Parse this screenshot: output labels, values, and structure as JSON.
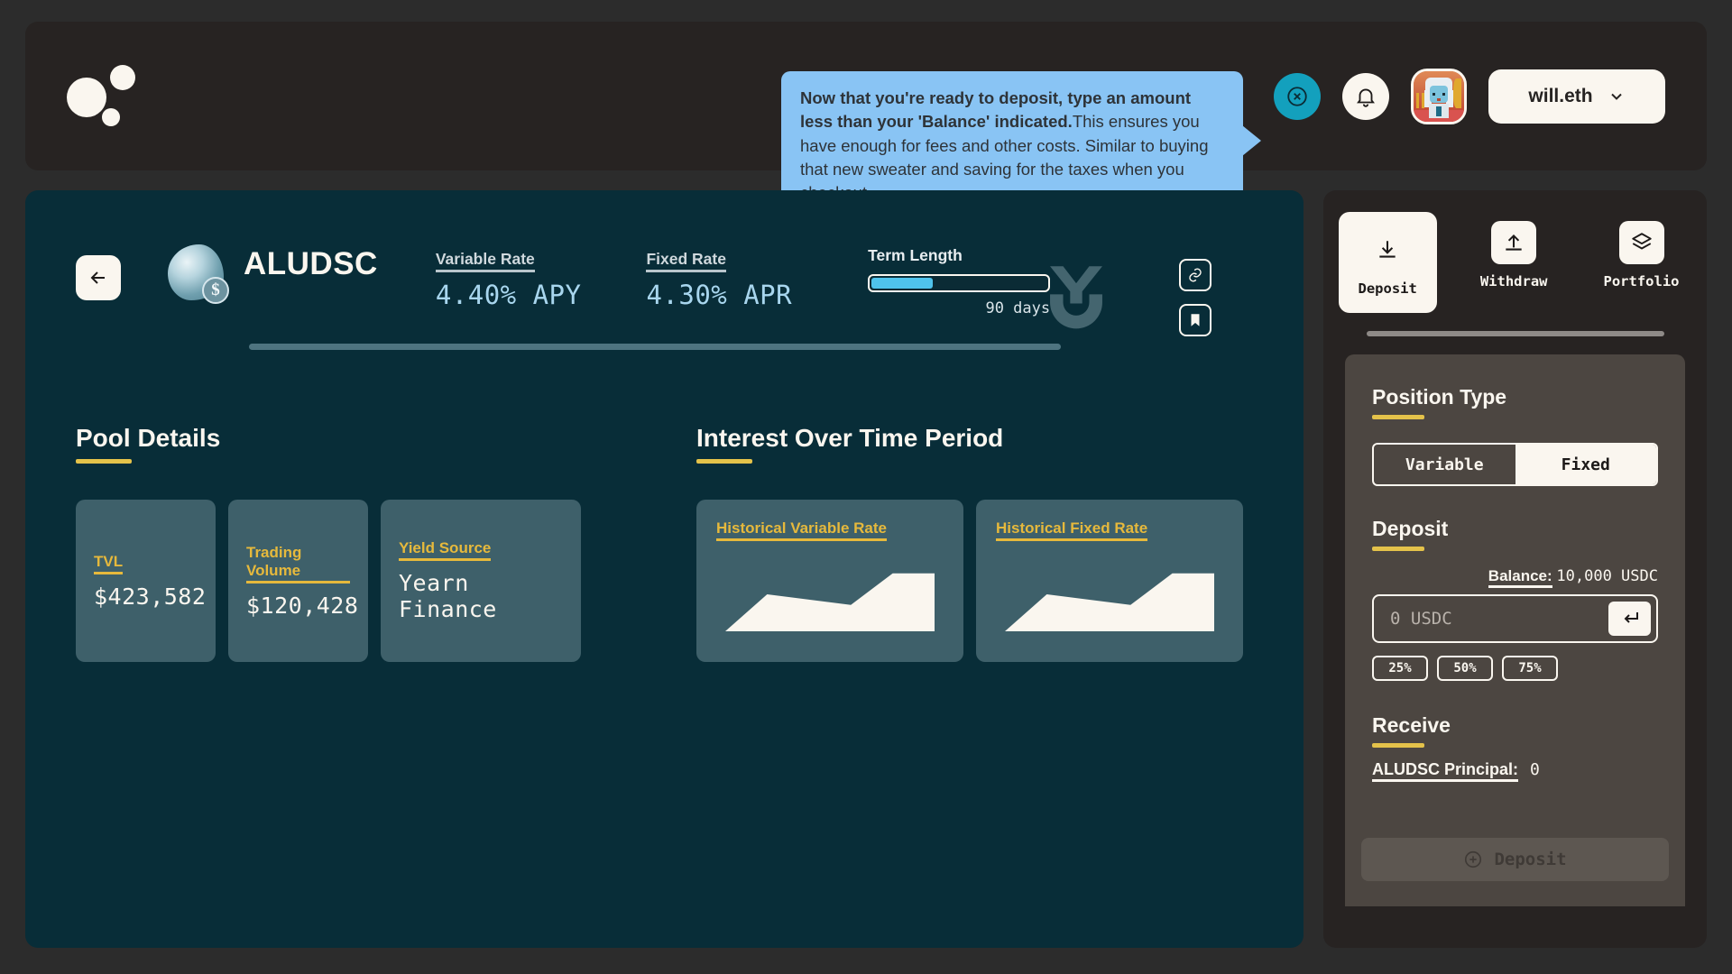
{
  "header": {
    "logo_name": "brand-dots-logo",
    "tooltip": {
      "bold": "Now that you're ready to deposit, type an amount less than your 'Balance' indicated.",
      "rest": "This ensures you have enough for fees and other costs. Similar to buying that new sweater and saving for the taxes when you checkout."
    },
    "close_label": "close-tour",
    "notifications_label": "notifications",
    "wallet": "will.eth",
    "accent_teal": "#13a0bd",
    "tooltip_bg": "#89c4f4"
  },
  "pool": {
    "back_label": "back",
    "name": "ALUDSC",
    "token_badge": "$",
    "variable": {
      "label": "Variable Rate",
      "value": "4.40% APY"
    },
    "fixed": {
      "label": "Fixed Rate",
      "value": "4.30% APR"
    },
    "term": {
      "label": "Term Length",
      "days": "90 days",
      "progress": 35
    },
    "protocol_logo": "yearn-y-logo",
    "link_label": "copy-link",
    "bookmark_label": "bookmark"
  },
  "pool_details": {
    "title": "Pool Details",
    "cards": [
      {
        "label": "TVL",
        "value": "$423,582"
      },
      {
        "label": "Trading Volume",
        "value": "$120,428"
      },
      {
        "label": "Yield Source",
        "value": "Yearn Finance"
      }
    ]
  },
  "interest": {
    "title": "Interest Over Time Period",
    "charts": [
      {
        "label": "Historical Variable Rate"
      },
      {
        "label": "Historical Fixed Rate"
      }
    ]
  },
  "chart_data": [
    {
      "type": "area",
      "title": "Historical Variable Rate",
      "x": [
        0,
        1,
        2,
        3,
        4,
        5
      ],
      "values": [
        0,
        42,
        36,
        30,
        66,
        66
      ],
      "ylabel": "",
      "xlabel": "",
      "grid": false,
      "legend": "none",
      "ylim": [
        0,
        80
      ]
    },
    {
      "type": "area",
      "title": "Historical Fixed Rate",
      "x": [
        0,
        1,
        2,
        3,
        4,
        5
      ],
      "values": [
        0,
        42,
        36,
        30,
        66,
        66
      ],
      "ylabel": "",
      "xlabel": "",
      "grid": false,
      "legend": "none",
      "ylim": [
        0,
        80
      ]
    }
  ],
  "sidebar": {
    "tabs": [
      {
        "label": "Deposit",
        "icon": "download-icon",
        "active": true
      },
      {
        "label": "Withdraw",
        "icon": "upload-icon",
        "active": false
      },
      {
        "label": "Portfolio",
        "icon": "layers-icon",
        "active": false
      }
    ],
    "position_type": {
      "title": "Position Type",
      "options": [
        "Variable",
        "Fixed"
      ],
      "selected": "Fixed"
    },
    "deposit": {
      "title": "Deposit",
      "balance_label": "Balance:",
      "balance_value": "10,000 USDC",
      "input_value": "",
      "input_placeholder": "0 USDC",
      "submit_icon": "enter-key-icon",
      "quick": [
        "25%",
        "50%",
        "75%"
      ]
    },
    "receive": {
      "title": "Receive",
      "principal_label": "ALUDSC Principal:",
      "principal_value": "0"
    },
    "cta": {
      "label": "Deposit",
      "icon": "plus-circle-icon",
      "disabled": true
    }
  },
  "colors": {
    "page_bg": "#2c2c2c",
    "header_bg": "#272322",
    "main_bg": "#082d38",
    "card_bg": "#3e606a",
    "panel_bg": "#4c4641",
    "cream": "#faf6ef",
    "yellow": "#e4c24a",
    "blue": "#a8d6ee"
  }
}
